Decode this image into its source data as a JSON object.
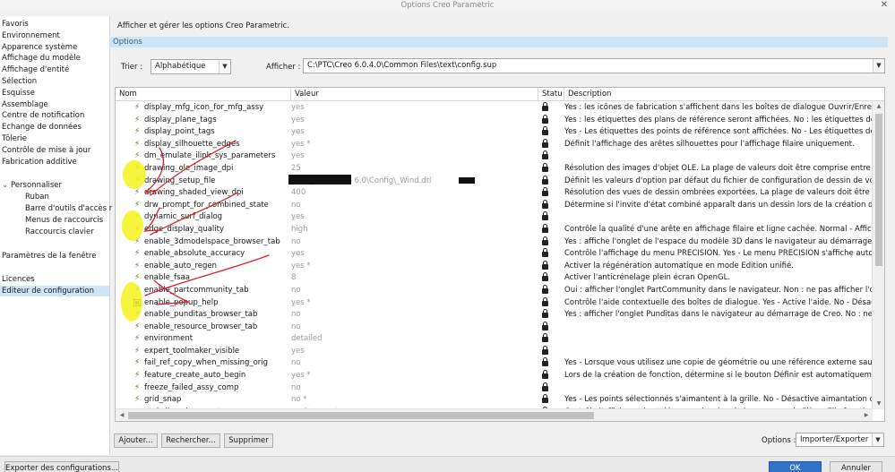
{
  "window": {
    "title": "Options Creo Parametric",
    "close": "✕"
  },
  "subtitle": "Afficher et gérer les options Creo Parametric.",
  "section": "Options",
  "sort": {
    "label": "Trier :",
    "value": "Alphabétique"
  },
  "display": {
    "label": "Afficher :",
    "value": "C:\\PTC\\Creo 6.0.4.0\\Common Files\\text\\config.sup"
  },
  "sidebar": {
    "items": [
      "Favoris",
      "Environnement",
      "Apparence système",
      "Affichage du modèle",
      "Affichage d'entité",
      "Sélection",
      "Esquisse",
      "Assemblage",
      "Centre de notification",
      "Echange de données",
      "Tôlerie",
      "Contrôle de mise à jour",
      "Fabrication additive"
    ],
    "customize_group": "Personnaliser",
    "customize_items": [
      "Ruban",
      "Barre d'outils d'accès r",
      "Menus de raccourcis",
      "Raccourcis clavier"
    ],
    "window_settings": "Paramètres de la fenêtre",
    "licenses": "Licences",
    "config_editor": "Editeur de configuration"
  },
  "table": {
    "headers": {
      "name": "Nom",
      "value": "Valeur",
      "status": "Statu",
      "description": "Description"
    },
    "rows": [
      {
        "name": "display_mfg_icon_for_mfg_assy",
        "value": "yes",
        "desc": "Yes : les icônes de fabrication s'affichent dans les boîtes de dialogue Ouvrir/Enregistrer",
        "icon": "bolt"
      },
      {
        "name": "display_plane_tags",
        "value": "yes",
        "desc": "Yes : les étiquettes des plans de référence seront affichées. No : les étiquettes des plans",
        "icon": "bolt"
      },
      {
        "name": "display_point_tags",
        "value": "yes",
        "desc": "Yes - Les étiquettes des points de référence sont affichées. No - Les étiquettes des points",
        "icon": "bolt"
      },
      {
        "name": "display_silhouette_edges",
        "value": "yes *",
        "desc": "Définit l'affichage des arêtes silhouettes pour l'affichage filaire uniquement.",
        "icon": "bolt"
      },
      {
        "name": "dm_emulate_ilink_sys_parameters",
        "value": "yes",
        "desc": "",
        "icon": "bolt"
      },
      {
        "name": "drawing_ole_image_dpi",
        "value": "25",
        "desc": "Résolution des images d'objet OLE. La plage de valeurs doit être comprise entre 0 et 600",
        "icon": "bolt"
      },
      {
        "name": "drawing_setup_file",
        "value": "onfig_Creo\\Creo 6.0\\Config\\_Wind.dtl",
        "desc": "Définit les valeurs d'option par défaut du fichier de configuration de dessin de votre ses",
        "icon": "bolt-blue"
      },
      {
        "name": "drawing_shaded_view_dpi",
        "value": "400",
        "desc": "Résolution des vues de dessin ombrées exportées. La plage de valeurs doit être compris",
        "icon": "bolt"
      },
      {
        "name": "drw_prompt_for_combined_state",
        "value": "no",
        "desc": "Détermine si l'invite d'état combiné apparaît dans un dessin lors de la création d'une vu",
        "icon": "bolt"
      },
      {
        "name": "dynamic_surf_dialog",
        "value": "yes",
        "desc": "",
        "icon": "bolt"
      },
      {
        "name": "edge_display_quality",
        "value": "high",
        "desc": "Contrôle la qualité d'une arête en affichage filaire et ligne cachée. Normal - Affichage d",
        "icon": "bolt"
      },
      {
        "name": "enable_3dmodelspace_browser_tab",
        "value": "no",
        "desc": "Yes : affiche l'onglet de l'espace du modèle 3D dans le navigateur au démarrage de Creo",
        "icon": "bolt"
      },
      {
        "name": "enable_absolute_accuracy",
        "value": "yes",
        "desc": "Contrôle l'affichage du menu PRECISION. Yes - Le menu PRECISION s'affiche automati",
        "icon": "bolt"
      },
      {
        "name": "enable_auto_regen",
        "value": "yes *",
        "desc": "Activer la régénération automatique en mode Edition unifié.",
        "icon": "bolt"
      },
      {
        "name": "enable_fsaa",
        "value": "8",
        "desc": "Activer l'anticrénelage plein écran OpenGL.",
        "icon": "bolt"
      },
      {
        "name": "enable_partcommunity_tab",
        "value": "no",
        "desc": "Oui : afficher l'onglet PartCommunity dans le navigateur. Non : ne pas afficher l'onglet",
        "icon": "bolt"
      },
      {
        "name": "enable_popup_help",
        "value": "yes *",
        "desc": "Contrôle l'aide contextuelle des boîtes de dialogue. Yes - Active l'aide. No - Désactive l",
        "icon": "box"
      },
      {
        "name": "enable_punditas_browser_tab",
        "value": "no",
        "desc": "Yes : afficher l'onglet Punditas dans le navigateur au démarrage de Creo. No : ne pas aff",
        "icon": "bolt"
      },
      {
        "name": "enable_resource_browser_tab",
        "value": "no",
        "desc": "",
        "icon": "bolt"
      },
      {
        "name": "environment",
        "value": "detailed",
        "desc": "",
        "icon": "bolt"
      },
      {
        "name": "expert_toolmaker_visible",
        "value": "yes",
        "desc": "",
        "icon": "bolt"
      },
      {
        "name": "fail_ref_copy_when_missing_orig",
        "value": "no",
        "desc": "Yes - Lorsque vous utilisez une copie de géométrie ou une référence externe sauvegard",
        "icon": "bolt"
      },
      {
        "name": "feature_create_auto_begin",
        "value": "yes *",
        "desc": "Lors de la création de fonction, détermine si le bouton Définir est automatiquement ac",
        "icon": "bolt"
      },
      {
        "name": "freeze_failed_assy_comp",
        "value": "no",
        "desc": "",
        "icon": "bolt"
      },
      {
        "name": "grid_snap",
        "value": "no *",
        "desc": "Yes -  Les points sélectionnés s'aimantent à la grille. No - Désactive aimantation de la g",
        "icon": "bolt"
      },
      {
        "name": "gtol_dim_placement",
        "value": "on_bottom *",
        "desc": "Contrôle l'affichage des tolérances de géométriques en mode Pièce. Elle fonctionne de",
        "icon": "bolt"
      }
    ]
  },
  "buttons": {
    "add": "Ajouter...",
    "search": "Rechercher...",
    "delete": "Supprimer",
    "options_label": "Options :",
    "import_export": "Importer/Exporter",
    "export": "Exporter des configurations...",
    "ok": "OK",
    "cancel": "Annuler"
  }
}
